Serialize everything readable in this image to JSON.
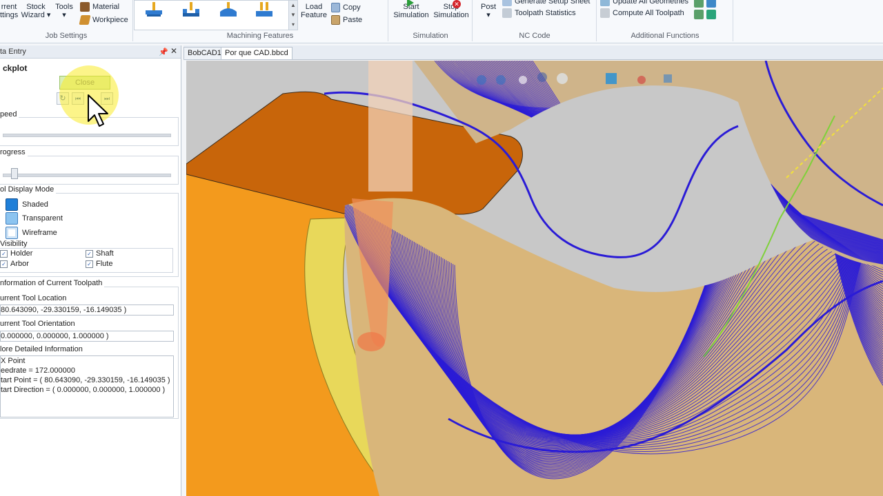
{
  "ribbon": {
    "job_settings": {
      "label": "Job Settings",
      "current_settings": "rrent\nttings",
      "stock_wizard": "Stock\nWizard ▾",
      "tools": "Tools\n▾",
      "material": "Material",
      "workpiece": "Workpiece"
    },
    "machining_features": {
      "label": "Machining Features",
      "load_feature": "Load\nFeature",
      "copy": "Copy",
      "paste": "Paste"
    },
    "simulation": {
      "label": "Simulation",
      "start": "Start\nSimulation",
      "stop": "Stop\nSimulation"
    },
    "nc_code": {
      "label": "NC Code",
      "post": "Post\n▾",
      "generate_setup_sheet": "Generate Setup Sheet",
      "toolpath_statistics": "Toolpath Statistics"
    },
    "additional": {
      "label": "Additional Functions",
      "update_all_geometries": "Update All Geometries",
      "compute_all_toolpath": "Compute All Toolpath"
    }
  },
  "panel": {
    "title": "ta Entry",
    "pin_icon": "pin-icon",
    "close_icon": "close-icon",
    "header": "ckplot",
    "close_button": "Close",
    "speed_label": "peed",
    "progress_label": "rogress",
    "progress_value": 0.05,
    "display_mode_label": "ol Display Mode",
    "modes": [
      "Shaded",
      "Transparent",
      "Wireframe"
    ],
    "visibility_label": "Visibility",
    "visibility": [
      {
        "label": "Holder",
        "checked": true
      },
      {
        "label": "Shaft",
        "checked": true
      },
      {
        "label": "Arbor",
        "checked": true
      },
      {
        "label": "Flute",
        "checked": true
      }
    ],
    "info_label": "nformation of Current Toolpath",
    "tool_location_label": "urrent Tool Location",
    "tool_location": " 80.643090, -29.330159, -16.149035 )",
    "tool_orientation_label": "urrent Tool Orientation",
    "tool_orientation": "0.000000, 0.000000, 1.000000 )",
    "detail_label": "lore Detailed Information",
    "detail_lines": [
      "X Point",
      "eedrate = 172.000000",
      "tart Point = ( 80.643090, -29.330159, -16.149035 )",
      "tart Direction = ( 0.000000, 0.000000, 1.000000 )"
    ]
  },
  "tabs": [
    "BobCAD1",
    "Por que CAD.bbcd"
  ],
  "colors": {
    "stock_orange": "#f39a1d",
    "dark_orange": "#c8650a",
    "toolpath_blue": "#2a1bd6",
    "highlight_yellow": "#f7ee3a"
  }
}
